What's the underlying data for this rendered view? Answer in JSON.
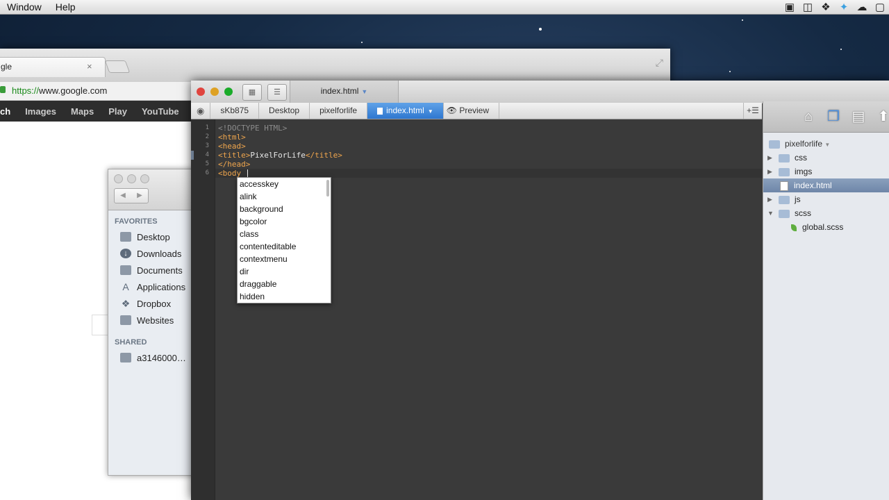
{
  "menubar": {
    "items": [
      "Window",
      "Help"
    ],
    "tray_icons": [
      "video-icon",
      "photo-icon",
      "dropbox-icon",
      "twitter-icon",
      "cloud-icon",
      "screen-icon"
    ]
  },
  "chrome": {
    "tab_title": "gle",
    "url_scheme": "https://",
    "url_rest": "www.google.com",
    "nav_links": [
      "ch",
      "Images",
      "Maps",
      "Play",
      "YouTube"
    ]
  },
  "finder": {
    "favorites_heading": "FAVORITES",
    "favorites": [
      {
        "label": "Desktop",
        "icon": "desktop-icon"
      },
      {
        "label": "Downloads",
        "icon": "downloads-icon"
      },
      {
        "label": "Documents",
        "icon": "documents-icon"
      },
      {
        "label": "Applications",
        "icon": "applications-icon"
      },
      {
        "label": "Dropbox",
        "icon": "dropbox-icon"
      },
      {
        "label": "Websites",
        "icon": "folder-icon"
      }
    ],
    "shared_heading": "SHARED",
    "shared": [
      {
        "label": "a3146000…",
        "icon": "computer-icon"
      }
    ]
  },
  "editor": {
    "tab_title": "index.html",
    "breadcrumbs": [
      "sKb875",
      "Desktop",
      "pixelforlife"
    ],
    "active_crumb": "index.html",
    "preview_label": "Preview",
    "line_numbers": [
      "1",
      "2",
      "3",
      "4",
      "5",
      "6"
    ],
    "code": {
      "l1": "<!DOCTYPE HTML>",
      "l2": "<html>",
      "l3": "<head>",
      "l4_open": "<title>",
      "l4_text": "PixelForLife",
      "l4_close": "</title>",
      "l5": "</head>",
      "l6": "<body "
    }
  },
  "autocomplete": [
    "accesskey",
    "alink",
    "background",
    "bgcolor",
    "class",
    "contenteditable",
    "contextmenu",
    "dir",
    "draggable",
    "hidden"
  ],
  "project": {
    "root": "pixelforlife",
    "items": [
      {
        "label": "css",
        "type": "folder"
      },
      {
        "label": "imgs",
        "type": "folder"
      },
      {
        "label": "index.html",
        "type": "file"
      },
      {
        "label": "js",
        "type": "folder"
      },
      {
        "label": "scss",
        "type": "folder"
      },
      {
        "label": "global.scss",
        "type": "file"
      }
    ]
  },
  "colors": {
    "accent": "#2f77cf",
    "tag": "#f0a64d",
    "editor_bg": "#3a3a3a"
  }
}
